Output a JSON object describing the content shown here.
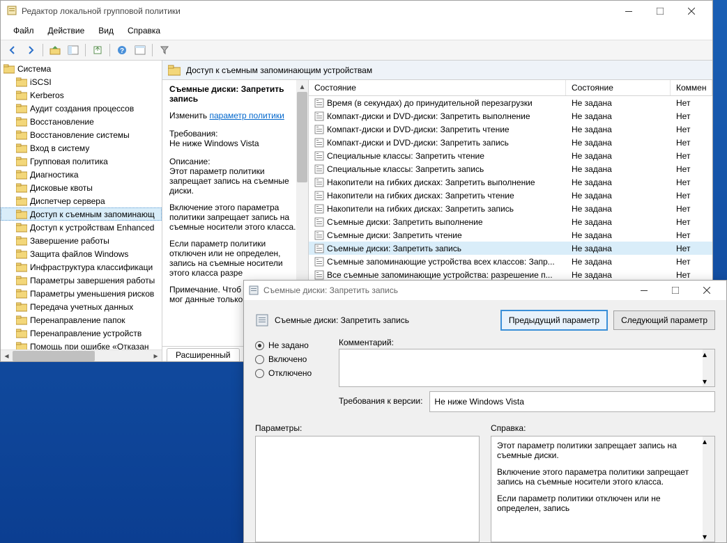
{
  "main_window": {
    "title": "Редактор локальной групповой политики",
    "menu": [
      "Файл",
      "Действие",
      "Вид",
      "Справка"
    ],
    "location": "Доступ к съемным запоминающим устройствам",
    "tabs": {
      "extended": "Расширенный"
    }
  },
  "tree": {
    "root": "Система",
    "items": [
      "iSCSI",
      "Kerberos",
      "Аудит создания процессов",
      "Восстановление",
      "Восстановление системы",
      "Вход в систему",
      "Групповая политика",
      "Диагностика",
      "Дисковые квоты",
      "Диспетчер сервера",
      "Доступ к съемным запоминающ",
      "Доступ к устройствам Enhanced",
      "Завершение работы",
      "Защита файлов Windows",
      "Инфраструктура классификаци",
      "Параметры завершения работы",
      "Параметры уменьшения рисков",
      "Передача учетных данных",
      "Перенаправление папок",
      "Перенаправление устройств",
      "Помощь при ошибке «Отказан"
    ],
    "selected_index": 10
  },
  "description": {
    "title": "Съемные диски: Запретить запись",
    "edit_label": "Изменить",
    "edit_link": "параметр политики",
    "req_label": "Требования:",
    "req_text": "Не ниже Windows Vista",
    "desc_label": "Описание:",
    "desc_text": "Этот параметр политики запрещает запись на съемные диски.",
    "desc_text2": "Включение этого параметра политики запрещает запись на съемные носители этого класса.",
    "desc_text3": "Если параметр политики отключен или не определен, запись на съемные носители этого класса разре",
    "desc_text4": "Примечание. Чтоб пользователи мог данные только на"
  },
  "list": {
    "columns": [
      "Состояние",
      "Состояние",
      "Коммен"
    ],
    "rows": [
      {
        "name": "Время (в секундах) до принудительной перезагрузки",
        "state": "Не задана",
        "comment": "Нет"
      },
      {
        "name": "Компакт-диски и DVD-диски: Запретить выполнение",
        "state": "Не задана",
        "comment": "Нет"
      },
      {
        "name": "Компакт-диски и DVD-диски: Запретить чтение",
        "state": "Не задана",
        "comment": "Нет"
      },
      {
        "name": "Компакт-диски и DVD-диски: Запретить запись",
        "state": "Не задана",
        "comment": "Нет"
      },
      {
        "name": "Специальные классы: Запретить чтение",
        "state": "Не задана",
        "comment": "Нет"
      },
      {
        "name": "Специальные классы: Запретить запись",
        "state": "Не задана",
        "comment": "Нет"
      },
      {
        "name": "Накопители на гибких дисках: Запретить выполнение",
        "state": "Не задана",
        "comment": "Нет"
      },
      {
        "name": "Накопители на гибких дисках: Запретить чтение",
        "state": "Не задана",
        "comment": "Нет"
      },
      {
        "name": "Накопители на гибких дисках: Запретить запись",
        "state": "Не задана",
        "comment": "Нет"
      },
      {
        "name": "Съемные диски: Запретить выполнение",
        "state": "Не задана",
        "comment": "Нет"
      },
      {
        "name": "Съемные диски: Запретить чтение",
        "state": "Не задана",
        "comment": "Нет"
      },
      {
        "name": "Съемные диски: Запретить запись",
        "state": "Не задана",
        "comment": "Нет"
      },
      {
        "name": "Съемные запоминающие устройства всех классов: Запр...",
        "state": "Не задана",
        "comment": "Нет"
      },
      {
        "name": "Все съемные запоминающие устройства: разрешение п...",
        "state": "Не задана",
        "comment": "Нет"
      }
    ],
    "selected_index": 11
  },
  "dialog": {
    "title": "Съемные диски: Запретить запись",
    "header": "Съемные диски: Запретить запись",
    "prev_btn": "Предыдущий параметр",
    "next_btn": "Следующий параметр",
    "radio": {
      "not_set": "Не задано",
      "enabled": "Включено",
      "disabled": "Отключено"
    },
    "comment_label": "Комментарий:",
    "version_label": "Требования к версии:",
    "version_value": "Не ниже Windows Vista",
    "params_label": "Параметры:",
    "help_label": "Справка:",
    "help_p1": "Этот параметр политики запрещает запись на съемные диски.",
    "help_p2": "Включение этого параметра политики запрещает запись на съемные носители этого класса.",
    "help_p3": "Если параметр политики отключен или не определен, запись"
  }
}
